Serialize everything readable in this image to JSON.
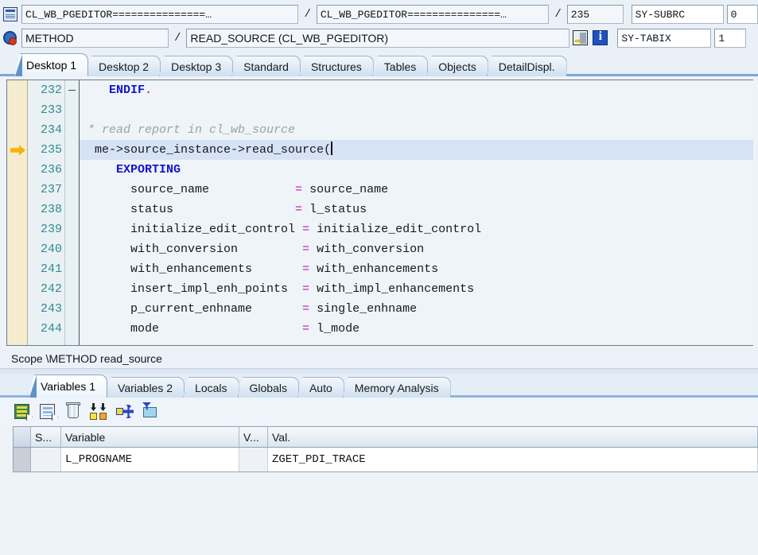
{
  "header": {
    "row1": {
      "icon": "program-icon",
      "program_field": "CL_WB_PGEDITOR===============…",
      "sep1": "/",
      "include_field": "CL_WB_PGEDITOR===============…",
      "sep2": "/",
      "line_field": "235",
      "sysfield_label": "SY-SUBRC",
      "sysfield_value": "0"
    },
    "row2": {
      "icon": "gear-icon",
      "event_field": "METHOD",
      "sep1": "/",
      "method_field": "READ_SOURCE (CL_WB_PGEDITOR)",
      "debug_icon": "debug-step-icon",
      "info_icon": "info-icon",
      "sysfield_label": "SY-TABIX",
      "sysfield_value": "1"
    }
  },
  "top_tabs": {
    "active_index": 0,
    "items": [
      {
        "label": "Desktop 1"
      },
      {
        "label": "Desktop 2"
      },
      {
        "label": "Desktop 3"
      },
      {
        "label": "Standard"
      },
      {
        "label": "Structures"
      },
      {
        "label": "Tables"
      },
      {
        "label": "Objects"
      },
      {
        "label": "DetailDispl."
      }
    ]
  },
  "editor": {
    "current_line": "235",
    "lines": [
      {
        "num": "232",
        "marker": "",
        "fold": "end",
        "segments": [
          {
            "text": "   ",
            "style": "plain"
          },
          {
            "text": "ENDIF",
            "style": "kw"
          },
          {
            "text": ".",
            "style": "dot"
          }
        ]
      },
      {
        "num": "233",
        "marker": "",
        "fold": "",
        "segments": []
      },
      {
        "num": "234",
        "marker": "",
        "fold": "",
        "segments": [
          {
            "text": "* read report in cl_wb_source",
            "style": "cmt"
          }
        ]
      },
      {
        "num": "235",
        "marker": "arrow",
        "fold": "",
        "current": true,
        "segments": [
          {
            "text": " me->source_instance->read_source(",
            "style": "plain"
          },
          {
            "text": "",
            "style": "caret"
          }
        ]
      },
      {
        "num": "236",
        "marker": "",
        "fold": "",
        "segments": [
          {
            "text": "    ",
            "style": "plain"
          },
          {
            "text": "EXPORTING",
            "style": "kw"
          }
        ]
      },
      {
        "num": "237",
        "marker": "",
        "fold": "",
        "segments": [
          {
            "text": "      source_name            ",
            "style": "plain"
          },
          {
            "text": "=",
            "style": "eq"
          },
          {
            "text": " source_name",
            "style": "plain"
          }
        ]
      },
      {
        "num": "238",
        "marker": "",
        "fold": "",
        "segments": [
          {
            "text": "      status                 ",
            "style": "plain"
          },
          {
            "text": "=",
            "style": "eq"
          },
          {
            "text": " l_status",
            "style": "plain"
          }
        ]
      },
      {
        "num": "239",
        "marker": "",
        "fold": "",
        "segments": [
          {
            "text": "      initialize_edit_control ",
            "style": "plain"
          },
          {
            "text": "=",
            "style": "eq"
          },
          {
            "text": " initialize_edit_control",
            "style": "plain"
          }
        ]
      },
      {
        "num": "240",
        "marker": "",
        "fold": "",
        "segments": [
          {
            "text": "      with_conversion         ",
            "style": "plain"
          },
          {
            "text": "=",
            "style": "eq"
          },
          {
            "text": " with_conversion",
            "style": "plain"
          }
        ]
      },
      {
        "num": "241",
        "marker": "",
        "fold": "",
        "segments": [
          {
            "text": "      with_enhancements       ",
            "style": "plain"
          },
          {
            "text": "=",
            "style": "eq"
          },
          {
            "text": " with_enhancements",
            "style": "plain"
          }
        ]
      },
      {
        "num": "242",
        "marker": "",
        "fold": "",
        "segments": [
          {
            "text": "      insert_impl_enh_points  ",
            "style": "plain"
          },
          {
            "text": "=",
            "style": "eq"
          },
          {
            "text": " with_impl_enhancements",
            "style": "plain"
          }
        ]
      },
      {
        "num": "243",
        "marker": "",
        "fold": "",
        "segments": [
          {
            "text": "      p_current_enhname       ",
            "style": "plain"
          },
          {
            "text": "=",
            "style": "eq"
          },
          {
            "text": " single_enhname",
            "style": "plain"
          }
        ]
      },
      {
        "num": "244",
        "marker": "",
        "fold": "",
        "segments": [
          {
            "text": "      mode                    ",
            "style": "plain"
          },
          {
            "text": "=",
            "style": "eq"
          },
          {
            "text": " l_mode",
            "style": "plain"
          }
        ]
      }
    ]
  },
  "scope": {
    "text": "Scope \\METHOD read_source"
  },
  "bottom_tabs": {
    "active_index": 0,
    "items": [
      {
        "label": "Variables 1"
      },
      {
        "label": "Variables 2"
      },
      {
        "label": "Locals"
      },
      {
        "label": "Globals"
      },
      {
        "label": "Auto"
      },
      {
        "label": "Memory Analysis"
      }
    ]
  },
  "var_toolbar": {
    "buttons": [
      {
        "name": "create-variable-icon",
        "title": ""
      },
      {
        "name": "copy-variable-icon",
        "title": ""
      },
      {
        "name": "delete-variable-icon",
        "title": ""
      },
      {
        "name": "sort-variables-icon",
        "title": ""
      },
      {
        "name": "exchange-variable-icon",
        "title": ""
      },
      {
        "name": "filter-folder-icon",
        "title": ""
      }
    ]
  },
  "var_table": {
    "columns": [
      {
        "key": "sel",
        "label": ""
      },
      {
        "key": "s",
        "label": "S..."
      },
      {
        "key": "variable",
        "label": "Variable"
      },
      {
        "key": "v",
        "label": "V..."
      },
      {
        "key": "val",
        "label": "Val."
      }
    ],
    "rows": [
      {
        "sel": "",
        "s": "",
        "variable": "L_PROGNAME",
        "v": "",
        "val": "ZGET_PDI_TRACE"
      }
    ]
  },
  "colors": {
    "keyword": "#1414cc",
    "comment": "#9aa3ab",
    "assign": "#c018b4",
    "line_number": "#2e8a94",
    "current_line_bg": "#d6e2f5",
    "marker_arrow": "#f5b400",
    "tab_accent": "#5e93cc"
  }
}
